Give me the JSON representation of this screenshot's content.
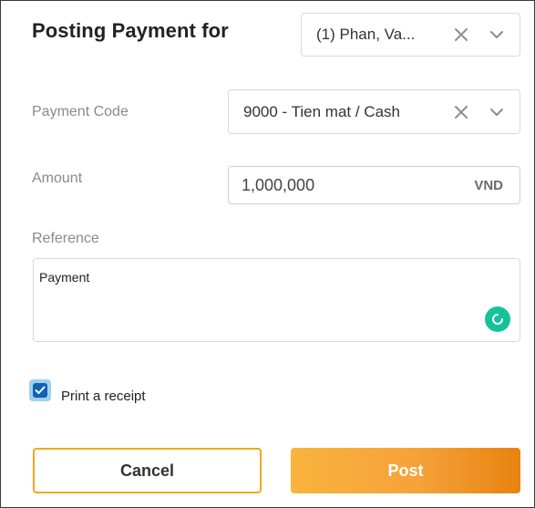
{
  "dialog": {
    "title": "Posting Payment for",
    "patient_select": {
      "value": "(1) Phan, Va..."
    }
  },
  "form": {
    "payment_code": {
      "label": "Payment Code",
      "value": "9000 - Tien mat / Cash"
    },
    "amount": {
      "label": "Amount",
      "value": "1,000,000",
      "unit": "VND"
    },
    "reference": {
      "label": "Reference",
      "value": "Payment"
    },
    "print_receipt": {
      "label": "Print a receipt",
      "checked": true
    }
  },
  "buttons": {
    "cancel": "Cancel",
    "post": "Post"
  },
  "colors": {
    "accent_orange": "#f5a623",
    "checkbox_blue": "#0f62b4",
    "grammar_green": "#15c39a"
  }
}
